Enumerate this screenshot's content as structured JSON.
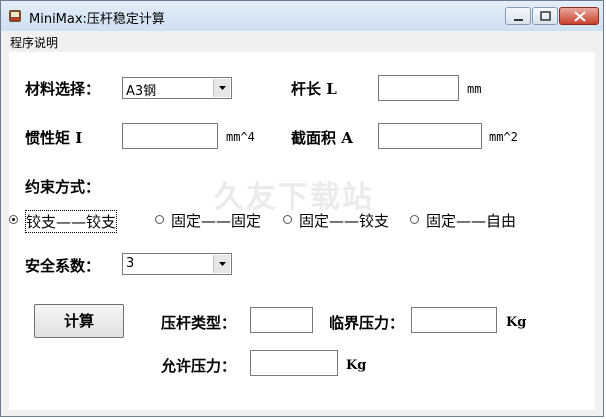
{
  "window": {
    "title": "MiniMax:压杆稳定计算"
  },
  "menu": {
    "items": [
      "程序说明"
    ]
  },
  "form": {
    "material_label": "材料选择：",
    "material_value": "A3钢",
    "length_label": "杆长 L",
    "length_value": "",
    "length_unit": "mm",
    "inertia_label": "惯性矩 I",
    "inertia_value": "",
    "inertia_unit": "mm^4",
    "area_label": "截面积 A",
    "area_value": "",
    "area_unit": "mm^2",
    "constraint_label": "约束方式：",
    "constraint_options": [
      "铰支——铰支",
      "固定——固定",
      "固定——铰支",
      "固定——自由"
    ],
    "constraint_selected_index": 0,
    "safety_label": "安全系数：",
    "safety_value": "3",
    "calc_button": "计算",
    "type_label": "压杆类型：",
    "type_value": "",
    "critical_label": "临界压力：",
    "critical_value": "",
    "critical_unit": "Kg",
    "allowed_label": "允许压力：",
    "allowed_value": "",
    "allowed_unit": "Kg"
  },
  "watermark": "久友下载站",
  "icons": {
    "app": "app-icon",
    "minimize": "minimize-icon",
    "maximize": "maximize-icon",
    "close": "close-icon",
    "dropdown": "chevron-down-icon"
  }
}
